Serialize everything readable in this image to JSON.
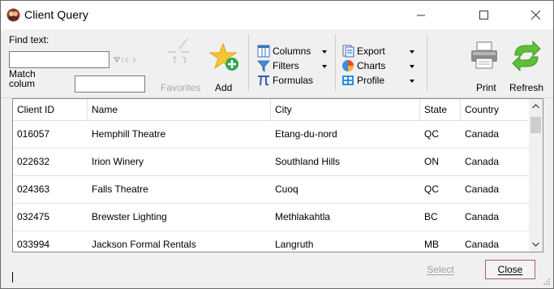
{
  "window": {
    "title": "Client Query"
  },
  "toolbar": {
    "find_text_label": "Find text:",
    "find_text_value": "",
    "match_column_label_1": "Match",
    "match_column_label_2": "colum",
    "match_column_value": "",
    "favorites_label": "Favorites",
    "add_label": "Add",
    "columns_label": "Columns",
    "filters_label": "Filters",
    "formulas_label": "Formulas",
    "export_label": "Export",
    "charts_label": "Charts",
    "profile_label": "Profile",
    "print_label": "Print",
    "refresh_label": "Refresh"
  },
  "grid": {
    "columns": [
      "Client ID",
      "Name",
      "City",
      "State",
      "Country"
    ],
    "rows": [
      [
        "016057",
        "Hemphill Theatre",
        "Etang-du-nord",
        "QC",
        "Canada"
      ],
      [
        "022632",
        "Irion Winery",
        "Southland Hills",
        "ON",
        "Canada"
      ],
      [
        "024363",
        "Falls Theatre",
        "Cuoq",
        "QC",
        "Canada"
      ],
      [
        "032475",
        "Brewster Lighting",
        "Methlakahtla",
        "BC",
        "Canada"
      ],
      [
        "033994",
        "Jackson Formal Rentals",
        "Langruth",
        "MB",
        "Canada"
      ]
    ]
  },
  "footer": {
    "status_text": "",
    "select_label": "Select",
    "close_label": "Close"
  }
}
